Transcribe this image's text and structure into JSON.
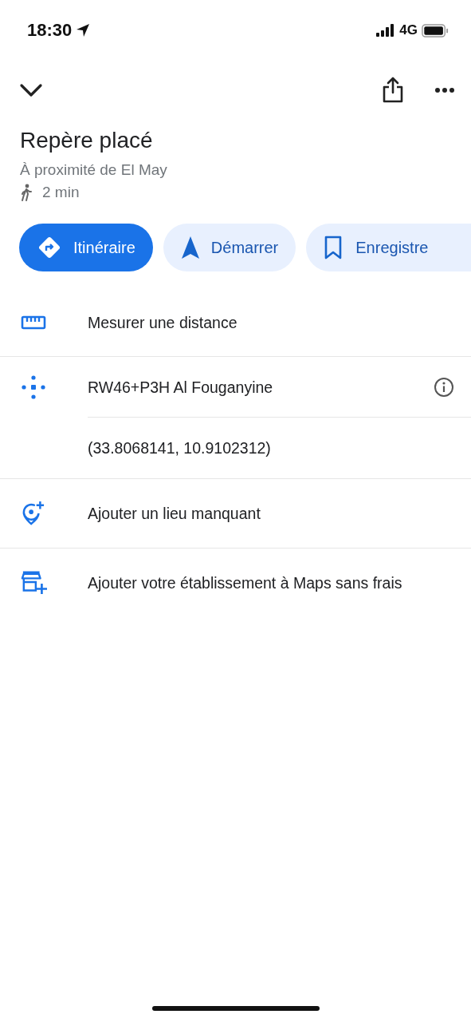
{
  "status_bar": {
    "time": "18:30",
    "network": "4G"
  },
  "place": {
    "title": "Repère placé",
    "subtitle": "À proximité de El May",
    "walk_time": "2 min"
  },
  "actions": [
    {
      "label": "Itinéraire",
      "kind": "directions"
    },
    {
      "label": "Démarrer",
      "kind": "start"
    },
    {
      "label": "Enregistre",
      "kind": "save"
    }
  ],
  "detail_groups": [
    [
      {
        "kind": "measure",
        "text": "Mesurer une distance",
        "info": false
      }
    ],
    [
      {
        "kind": "pluscode",
        "text": "RW46+P3H Al Fouganyine",
        "info": true
      },
      {
        "kind": "coordinates",
        "text": "(33.8068141, 10.9102312)",
        "info": false
      }
    ],
    [
      {
        "kind": "add-place",
        "text": "Ajouter un lieu manquant",
        "info": false
      }
    ],
    [
      {
        "kind": "add-business",
        "text": "Ajouter votre établissement à Maps sans frais",
        "info": false
      }
    ]
  ]
}
